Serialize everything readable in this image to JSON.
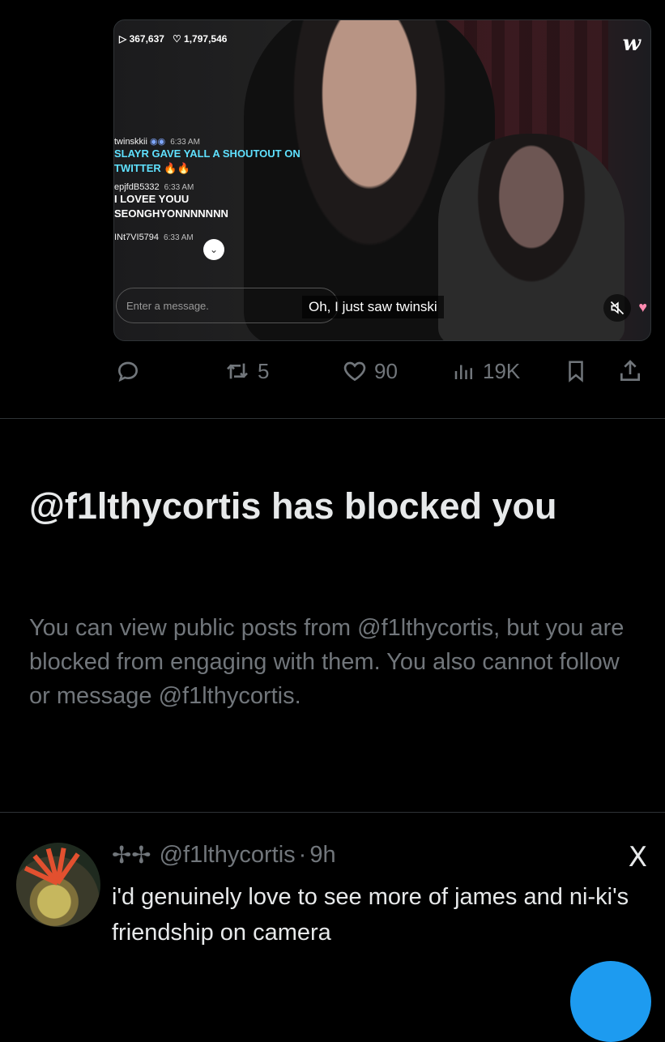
{
  "media": {
    "views": "367,637",
    "likes": "1,797,546",
    "brand": "w",
    "chat": [
      {
        "user": "twinskkii",
        "time": "6:33 AM",
        "lines": [
          "SLAYR GAVE YALL A SHOUTOUT ON",
          "TWITTER 🔥🔥"
        ],
        "highlight": true
      },
      {
        "user": "epjfdB5332",
        "time": "6:33 AM",
        "lines": [
          "I LOVEE YOUU",
          "SEONGHYONNNNNNN"
        ],
        "highlight": false
      },
      {
        "user": "INt7VI5794",
        "time": "6:33 AM",
        "lines": [],
        "highlight": false
      }
    ],
    "input_placeholder": "Enter a message.",
    "subtitle": "Oh, I just saw twinski"
  },
  "tweet_actions": {
    "retweets": "5",
    "likes": "90",
    "views": "19K"
  },
  "blocked": {
    "title": "@f1lthycortis has blocked you",
    "body": "You can view public posts from @f1lthycortis, but you are blocked from engaging with them. You also cannot follow or message @f1lthycortis."
  },
  "reply": {
    "prefix": "✢✢",
    "handle": "@f1lthycortis",
    "sep": "·",
    "age": "9h",
    "text": "i'd genuinely love to see more of james and ni-ki's friendship on camera",
    "platform_icon": "X"
  }
}
